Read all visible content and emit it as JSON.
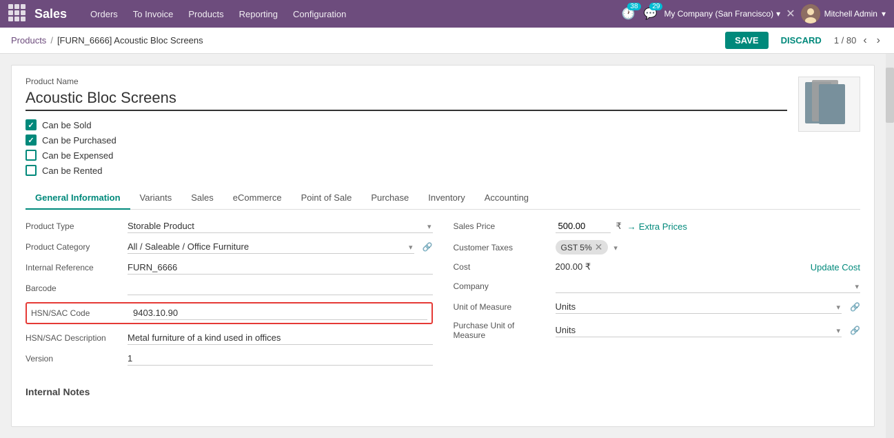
{
  "topnav": {
    "brand": "Sales",
    "menu": [
      "Orders",
      "To Invoice",
      "Products",
      "Reporting",
      "Configuration"
    ],
    "badge_activity": "38",
    "badge_messages": "29",
    "company": "My Company (San Francisco)",
    "user": "Mitchell Admin"
  },
  "breadcrumb": {
    "parent": "Products",
    "separator": "/",
    "current": "[FURN_6666] Acoustic Bloc Screens"
  },
  "actions": {
    "save": "SAVE",
    "discard": "DISCARD",
    "pager": "1 / 80"
  },
  "product": {
    "name_label": "Product Name",
    "name": "Acoustic Bloc Screens",
    "checkboxes": [
      {
        "label": "Can be Sold",
        "checked": true
      },
      {
        "label": "Can be Purchased",
        "checked": true
      },
      {
        "label": "Can be Expensed",
        "checked": false
      },
      {
        "label": "Can be Rented",
        "checked": false
      }
    ]
  },
  "tabs": [
    {
      "label": "General Information",
      "active": true
    },
    {
      "label": "Variants"
    },
    {
      "label": "Sales"
    },
    {
      "label": "eCommerce"
    },
    {
      "label": "Point of Sale"
    },
    {
      "label": "Purchase"
    },
    {
      "label": "Inventory"
    },
    {
      "label": "Accounting"
    }
  ],
  "general_info": {
    "left": {
      "product_type_label": "Product Type",
      "product_type_value": "Storable Product",
      "product_category_label": "Product Category",
      "product_category_value": "All / Saleable / Office Furniture",
      "internal_reference_label": "Internal Reference",
      "internal_reference_value": "FURN_6666",
      "barcode_label": "Barcode",
      "barcode_value": "",
      "hsn_code_label": "HSN/SAC Code",
      "hsn_code_value": "9403.10.90",
      "hsn_desc_label": "HSN/SAC Description",
      "hsn_desc_value": "Metal furniture of a kind used in offices",
      "version_label": "Version",
      "version_value": "1"
    },
    "right": {
      "sales_price_label": "Sales Price",
      "sales_price_value": "500.00",
      "currency": "₹",
      "extra_prices_label": "Extra Prices",
      "customer_taxes_label": "Customer Taxes",
      "customer_taxes_tag": "GST 5%",
      "cost_label": "Cost",
      "cost_value": "200.00 ₹",
      "update_cost_label": "Update Cost",
      "company_label": "Company",
      "company_value": "",
      "uom_label": "Unit of Measure",
      "uom_value": "Units",
      "puom_label": "Purchase Unit of Measure",
      "puom_value": "Units"
    }
  },
  "internal_notes_label": "Internal Notes"
}
